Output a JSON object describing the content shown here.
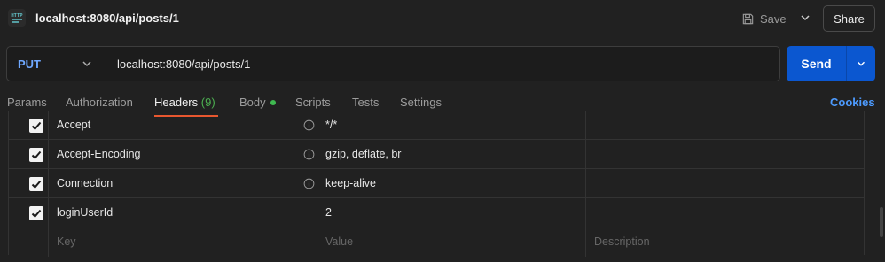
{
  "header": {
    "title": "localhost:8080/api/posts/1",
    "save_label": "Save",
    "share_label": "Share"
  },
  "request": {
    "method": "PUT",
    "url": "localhost:8080/api/posts/1",
    "send_label": "Send"
  },
  "tabs": [
    {
      "label": "Params"
    },
    {
      "label": "Authorization"
    },
    {
      "label": "Headers",
      "count": "(9)"
    },
    {
      "label": "Body"
    },
    {
      "label": "Scripts"
    },
    {
      "label": "Tests"
    },
    {
      "label": "Settings"
    }
  ],
  "cookies_label": "Cookies",
  "headers_table": {
    "rows": [
      {
        "key": "Accept",
        "value": "*/*",
        "description": ""
      },
      {
        "key": "Accept-Encoding",
        "value": "gzip, deflate, br",
        "description": ""
      },
      {
        "key": "Connection",
        "value": "keep-alive",
        "description": ""
      },
      {
        "key": "loginUserId",
        "value": "2",
        "description": ""
      }
    ],
    "placeholders": {
      "key": "Key",
      "value": "Value",
      "description": "Description"
    }
  },
  "colors": {
    "send": "#0b57d0",
    "method": "#6fa8ff",
    "active_underline": "#e8572f",
    "count": "#4caf50",
    "cookies": "#4d9bff"
  }
}
